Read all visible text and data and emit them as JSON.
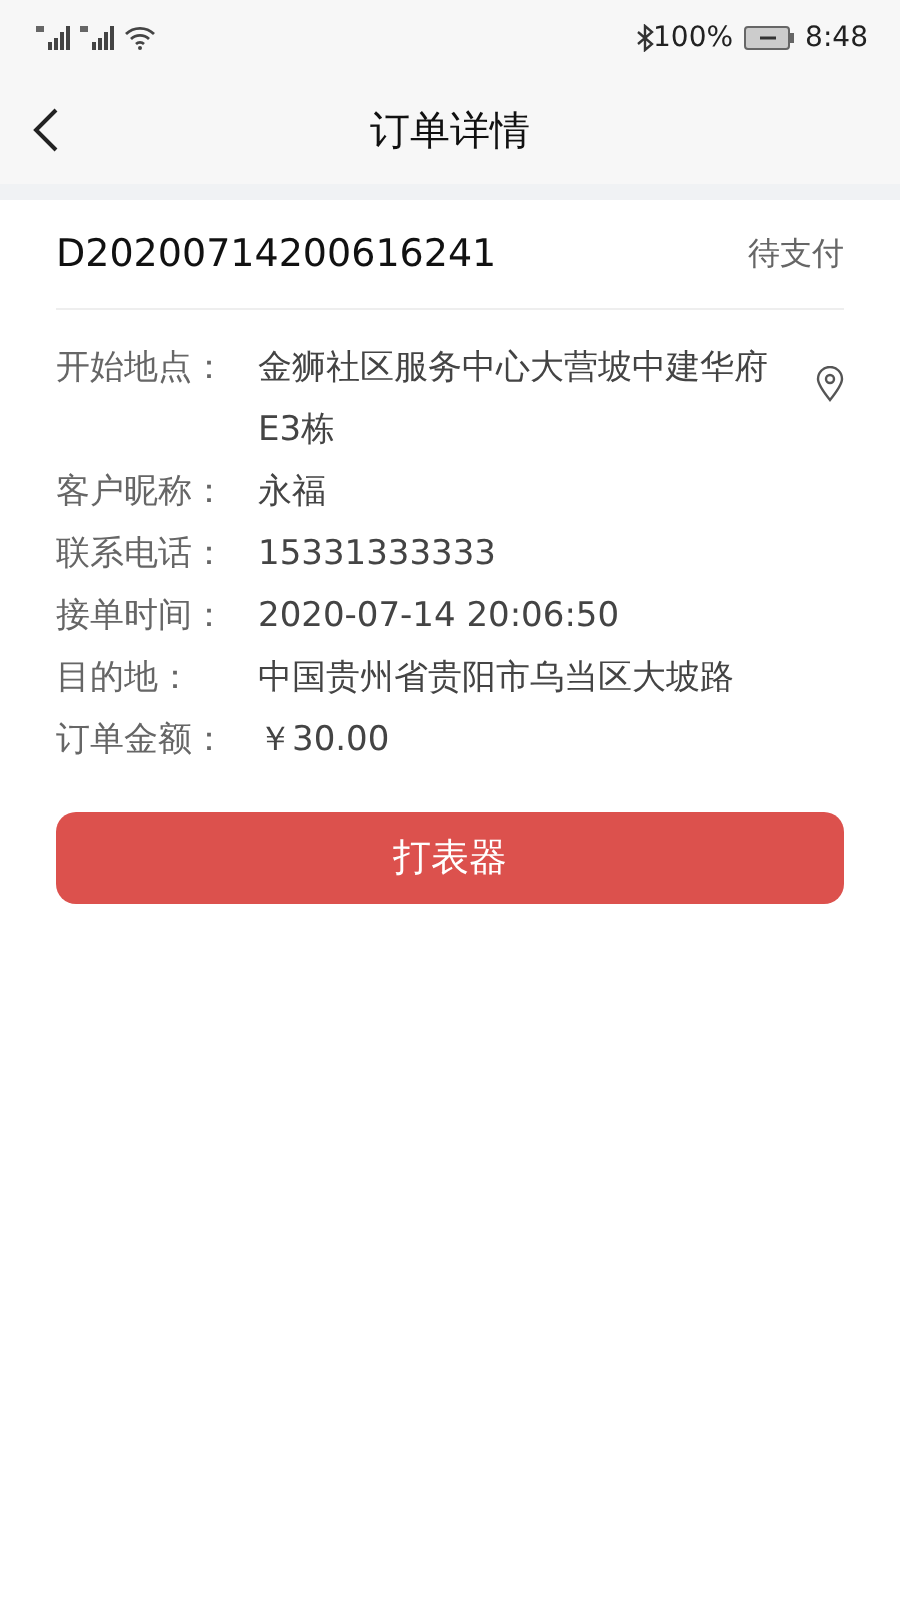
{
  "status_bar": {
    "battery_text": "100%",
    "time": "8:48"
  },
  "nav": {
    "title": "订单详情"
  },
  "order": {
    "number": "D20200714200616241",
    "status": "待支付"
  },
  "fields": [
    {
      "kind": "address",
      "label": "开始地点：",
      "value": "金狮社区服务中心大营坡中建华府E3栋"
    },
    {
      "kind": "plain",
      "label": "客户昵称：",
      "value": "永福"
    },
    {
      "kind": "plain",
      "label": "联系电话：",
      "value": "15331333333"
    },
    {
      "kind": "plain",
      "label": "接单时间：",
      "value": "2020-07-14 20:06:50"
    },
    {
      "kind": "plain",
      "label": "目的地：",
      "value": "中国贵州省贵阳市乌当区大坡路"
    },
    {
      "kind": "plain",
      "label": "订单金额：",
      "value": "￥30.00"
    }
  ],
  "action_button": {
    "label": "打表器"
  }
}
